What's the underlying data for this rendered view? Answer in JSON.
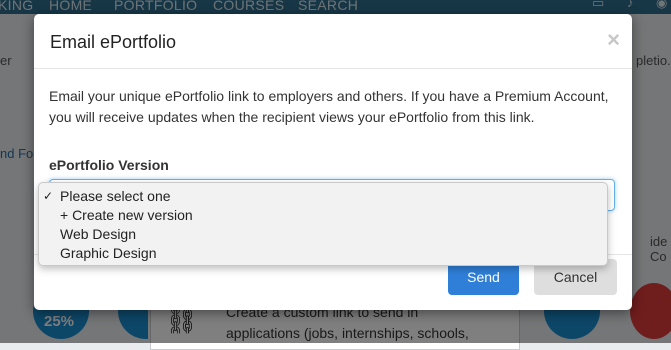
{
  "nav": {
    "items": [
      "KING",
      "HOME",
      "PORTFOLIO",
      "COURSES",
      "SEARCH"
    ],
    "icons": [
      "inbox-icon",
      "bell-icon",
      "user-icon"
    ]
  },
  "background": {
    "left_text": "er",
    "left_link": "nd Fo",
    "right_text": "pletio.",
    "right_text2": "ide Co",
    "progress_text": "25%",
    "card_text": [
      "Create a custom link to send in",
      "applications (jobs, internships, schools,"
    ]
  },
  "modal": {
    "title": "Email ePortfolio",
    "close_label": "×",
    "description": "Email your unique ePortfolio link to employers and others. If you have a Premium Account, you will receive updates when the recipient views your ePortfolio from this link.",
    "field_label": "ePortfolio Version",
    "send_label": "Send",
    "cancel_label": "Cancel"
  },
  "dropdown": {
    "selected_mark": "✓",
    "options": [
      "Please select one",
      "+ Create new version",
      "Web Design",
      "Graphic Design"
    ]
  },
  "colors": {
    "primary": "#2f7fd8",
    "nav": "#2f6f8f"
  }
}
